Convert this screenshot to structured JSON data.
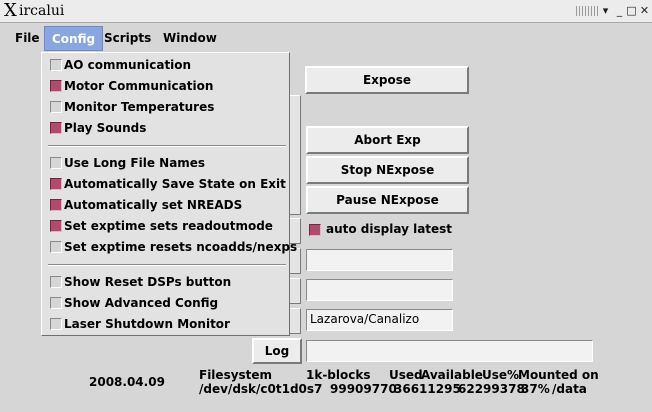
{
  "window": {
    "logo": "X",
    "title": "ircalui",
    "controls": {
      "menu": "▾",
      "minimize": "_",
      "maximize": "□",
      "close": "✕"
    }
  },
  "menubar": {
    "items": [
      {
        "label": "File"
      },
      {
        "label": "Config",
        "active": true
      },
      {
        "label": "Scripts"
      },
      {
        "label": "Window"
      }
    ]
  },
  "config_menu": {
    "groups": [
      [
        {
          "label": "AO communication",
          "checked": false
        },
        {
          "label": "Motor Communication",
          "checked": true
        },
        {
          "label": "Monitor Temperatures",
          "checked": false
        },
        {
          "label": "Play Sounds",
          "checked": true
        }
      ],
      [
        {
          "label": "Use Long File Names",
          "checked": false
        },
        {
          "label": "Automatically Save State on Exit",
          "checked": true
        },
        {
          "label": "Automatically set NREADS",
          "checked": true
        },
        {
          "label": "Set exptime sets readoutmode",
          "checked": true
        },
        {
          "label": "Set exptime resets ncoadds/nexps",
          "checked": false
        }
      ],
      [
        {
          "label": "Show Reset DSPs button",
          "checked": false
        },
        {
          "label": "Show Advanced Config",
          "checked": false
        },
        {
          "label": "Laser Shutdown Monitor",
          "checked": false
        }
      ]
    ]
  },
  "controls": {
    "expose": "Expose",
    "abort_exp": "Abort Exp",
    "stop_nexpose": "Stop NExpose",
    "pause_nexpose": "Pause NExpose",
    "auto_display_latest": {
      "label": "auto display latest",
      "checked": true
    },
    "field1": "",
    "field2": "",
    "observer": "Lazarova/Canalizo",
    "log_button": "Log",
    "log_field": ""
  },
  "status": {
    "date": "2008.04.09",
    "fs_header": [
      "Filesystem",
      "1k-blocks",
      "Used",
      "Available",
      "Use%",
      "Mounted on"
    ],
    "fs_row": [
      "/dev/dsk/c0t1d0s7",
      "99909770",
      "36611295",
      "62299378",
      "37%",
      "/data"
    ]
  },
  "colors": {
    "menu_highlight": "#8aa6e0",
    "checkbox_checked": "#b24a6e",
    "background": "#d6d6d6"
  }
}
